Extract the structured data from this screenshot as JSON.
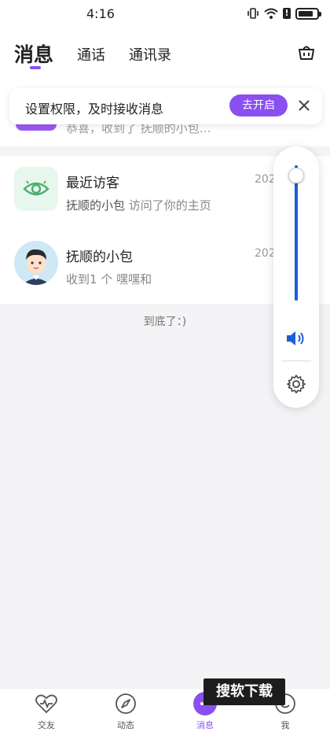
{
  "status_bar": {
    "time": "4:16",
    "battery_level": 0.8
  },
  "header": {
    "tabs": [
      "消息",
      "通话",
      "通讯录"
    ],
    "active_tab": "消息"
  },
  "notice": {
    "text": "设置权限，及时接收消息",
    "button_label": "去开启"
  },
  "messages": [
    {
      "subtitle": "恭喜，收到了 抚顺的小包…"
    },
    {
      "title": "最近访客",
      "subtitle_highlight": "抚顺的小包",
      "subtitle_rest": " 访问了你的主页",
      "date": "202",
      "icon": "eye-icon"
    },
    {
      "title": "抚顺的小包",
      "subtitle": "收到1 个 嘿嘿和",
      "date": "202",
      "icon": "boy-avatar"
    }
  ],
  "list_end_text": "到底了：)",
  "volume": {
    "level": 0.95
  },
  "bottom_nav": [
    {
      "label": "交友",
      "icon": "heartbeat-icon"
    },
    {
      "label": "动态",
      "icon": "compass-icon"
    },
    {
      "label": "消息",
      "icon": "message-icon",
      "active": true
    },
    {
      "label": "我",
      "icon": "profile-icon"
    }
  ],
  "watermark": "搜软下载",
  "colors": {
    "accent": "#8a4ff0",
    "volume": "#1a5fd6",
    "visitor_bg": "#e8f7ee"
  }
}
